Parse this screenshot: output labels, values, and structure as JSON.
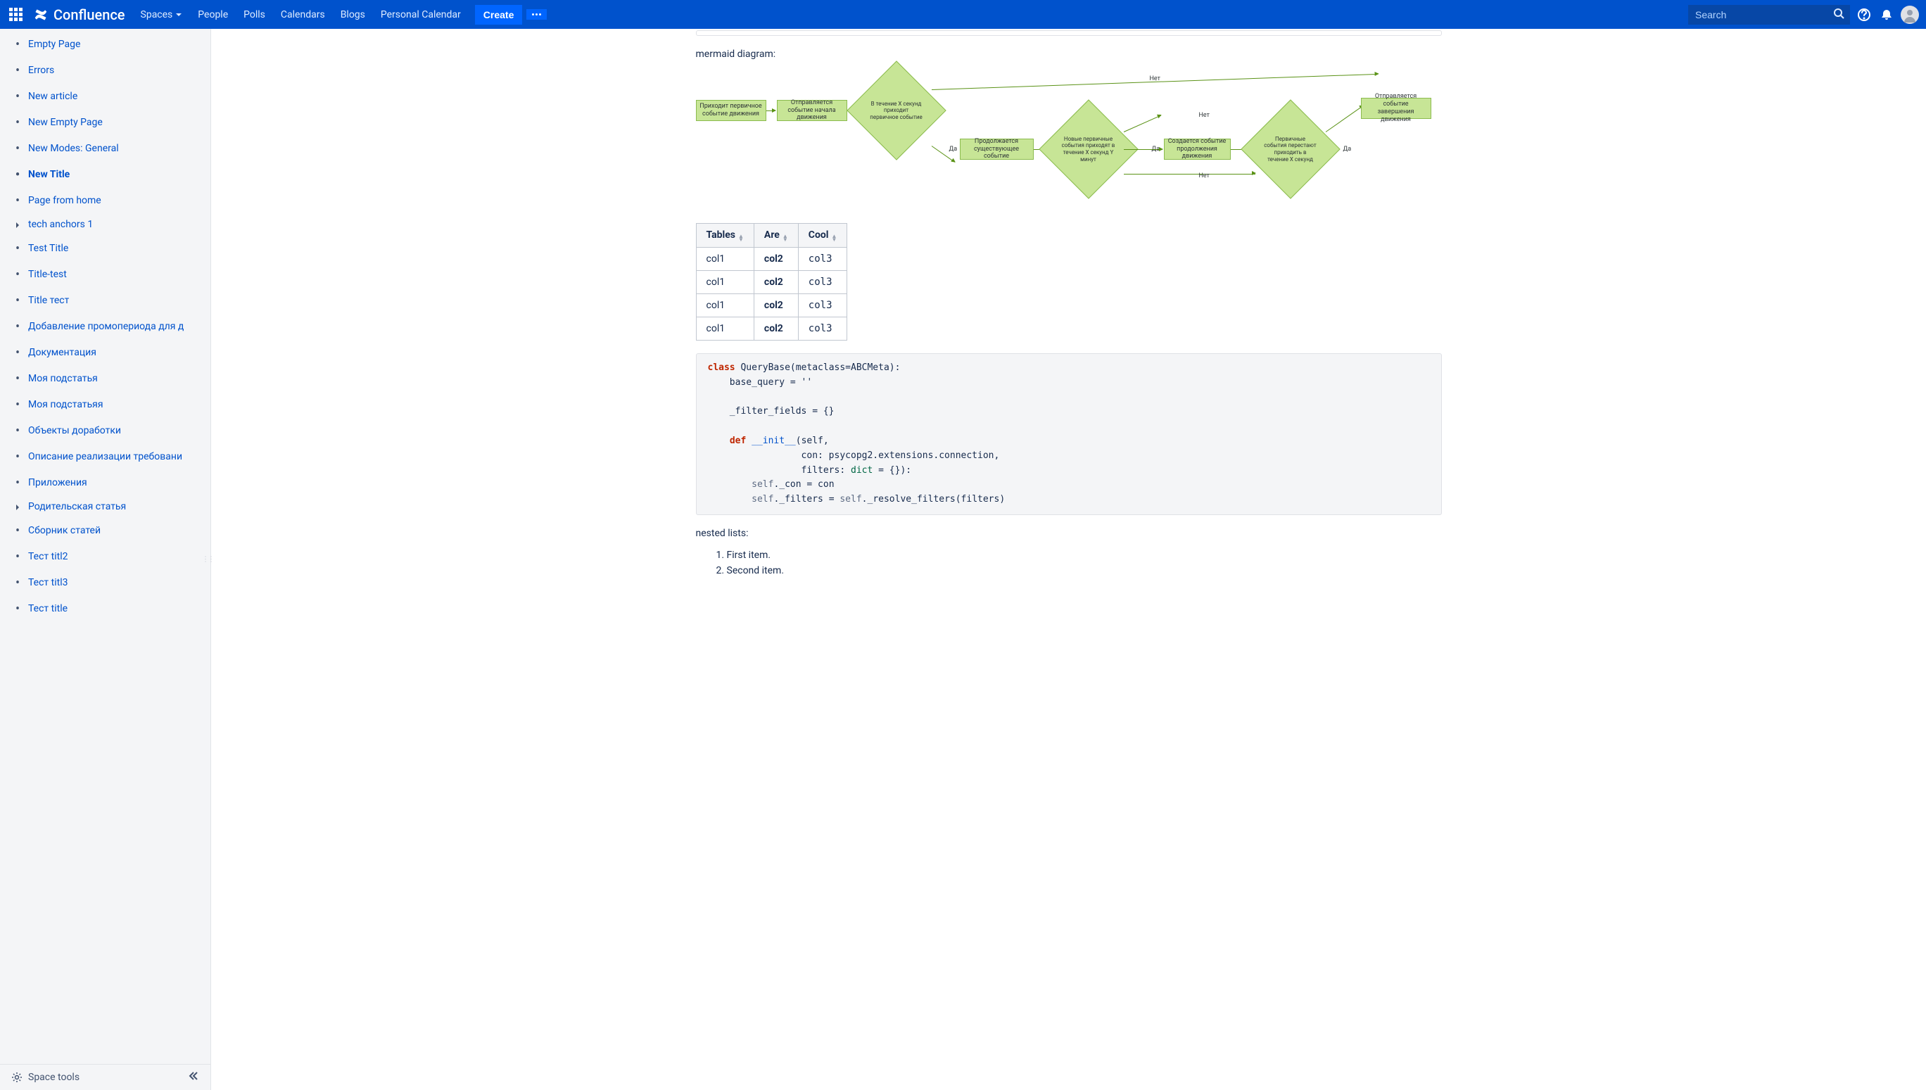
{
  "header": {
    "logo": "Confluence",
    "nav": [
      "Spaces",
      "People",
      "Polls",
      "Calendars",
      "Blogs",
      "Personal Calendar"
    ],
    "create": "Create",
    "search_placeholder": "Search"
  },
  "sidebar": {
    "items": [
      {
        "label": "Empty Page",
        "icon": "bullet",
        "active": false
      },
      {
        "label": "Errors",
        "icon": "bullet",
        "active": false
      },
      {
        "label": "New article",
        "icon": "bullet",
        "active": false
      },
      {
        "label": "New Empty Page",
        "icon": "bullet",
        "active": false
      },
      {
        "label": "New Modes: General",
        "icon": "bullet",
        "active": false
      },
      {
        "label": "New Title",
        "icon": "bullet",
        "active": true
      },
      {
        "label": "Page from home",
        "icon": "bullet",
        "active": false
      },
      {
        "label": "tech anchors 1",
        "icon": "chevron",
        "active": false
      },
      {
        "label": "Test Title",
        "icon": "bullet",
        "active": false
      },
      {
        "label": "Title-test",
        "icon": "bullet",
        "active": false
      },
      {
        "label": "Title тест",
        "icon": "bullet",
        "active": false
      },
      {
        "label": "Добавление промопериода для д",
        "icon": "bullet",
        "active": false
      },
      {
        "label": "Документация",
        "icon": "bullet",
        "active": false
      },
      {
        "label": "Моя подстатья",
        "icon": "bullet",
        "active": false
      },
      {
        "label": "Моя подстатьяя",
        "icon": "bullet",
        "active": false
      },
      {
        "label": "Объекты доработки",
        "icon": "bullet",
        "active": false
      },
      {
        "label": "Описание реализации требовани",
        "icon": "bullet",
        "active": false
      },
      {
        "label": "Приложения",
        "icon": "bullet",
        "active": false
      },
      {
        "label": "Родительская статья",
        "icon": "chevron",
        "active": false
      },
      {
        "label": "Сборник статей",
        "icon": "bullet",
        "active": false
      },
      {
        "label": "Тест titl2",
        "icon": "bullet",
        "active": false
      },
      {
        "label": "Тест titl3",
        "icon": "bullet",
        "active": false
      },
      {
        "label": "Тест title",
        "icon": "bullet",
        "active": false
      }
    ],
    "footer": "Space tools"
  },
  "content": {
    "diagram_label": "mermaid diagram:",
    "diagram": {
      "nodes": {
        "n1": "Приходит первичное событие движения",
        "n2": "Отправляется событие начала движения",
        "n3": "В течение X секунд приходит первичное событие",
        "n4": "Продолжается существующее событие",
        "n5": "Новые первичные события приходят в течение X секунд Y минут",
        "n6": "Создается событие продолжения движения",
        "n7": "Первичные события перестают приходить в течение X секунд",
        "n8": "Отправляется событие завершения движения"
      },
      "labels": {
        "yes": "Да",
        "no": "Нет"
      }
    },
    "table": {
      "headers": [
        "Tables",
        "Are",
        "Cool"
      ],
      "rows": [
        [
          "col1",
          "col2",
          "col3"
        ],
        [
          "col1",
          "col2",
          "col3"
        ],
        [
          "col1",
          "col2",
          "col3"
        ],
        [
          "col1",
          "col2",
          "col3"
        ]
      ]
    },
    "code": {
      "l1a": "class",
      "l1b": " QueryBase(metaclass=ABCMeta):",
      "l2": "    base_query = ''",
      "l3": "    _filter_fields = {}",
      "l4a": "    ",
      "l4b": "def",
      "l4c": " __init__",
      "l4d": "(self,",
      "l5": "                 con: psycopg2.extensions.connection,",
      "l6a": "                 filters: ",
      "l6b": "dict",
      "l6c": " = {}):",
      "l7a": "        ",
      "l7b": "self",
      "l7c": "._con = con",
      "l8a": "        ",
      "l8b": "self",
      "l8c": "._filters = ",
      "l8d": "self",
      "l8e": "._resolve_filters(filters)"
    },
    "nested_label": "nested lists:",
    "nested": [
      "First item.",
      "Second item."
    ]
  }
}
